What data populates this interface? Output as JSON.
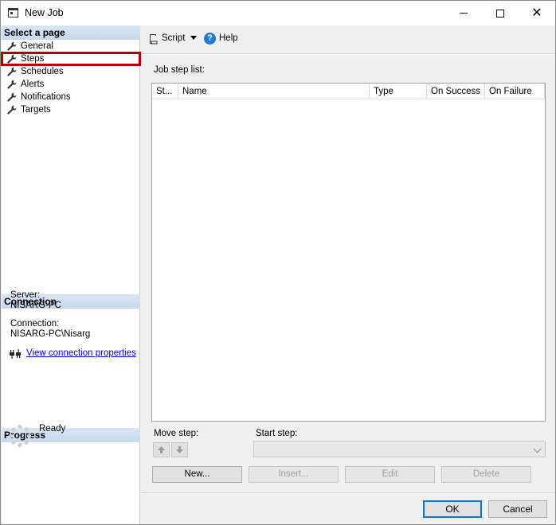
{
  "window": {
    "title": "New Job"
  },
  "left": {
    "select_page_header": "Select a page",
    "pages": [
      {
        "label": "General"
      },
      {
        "label": "Steps"
      },
      {
        "label": "Schedules"
      },
      {
        "label": "Alerts"
      },
      {
        "label": "Notifications"
      },
      {
        "label": "Targets"
      }
    ],
    "selected_page": "Steps",
    "connection_header": "Connection",
    "server_label": "Server:",
    "server_value": "NISARG-PC",
    "connection_label": "Connection:",
    "connection_value": "NISARG-PC\\Nisarg",
    "view_connection_link": "View connection properties",
    "progress_header": "Progress",
    "progress_status": "Ready"
  },
  "toolbar": {
    "script_label": "Script",
    "help_label": "Help"
  },
  "steps": {
    "list_label": "Job step list:",
    "columns": [
      "St...",
      "Name",
      "Type",
      "On Success",
      "On Failure"
    ],
    "rows": [],
    "move_step_label": "Move step:",
    "start_step_label": "Start step:",
    "start_step_value": "",
    "new_label": "New...",
    "insert_label": "Insert...",
    "edit_label": "Edit",
    "delete_label": "Delete"
  },
  "footer": {
    "ok_label": "OK",
    "cancel_label": "Cancel"
  },
  "colors": {
    "selection_outline": "#b00000",
    "link": "#0000ee",
    "ok_focus_border": "#0078d7",
    "help_icon": "#1e7bd0"
  }
}
